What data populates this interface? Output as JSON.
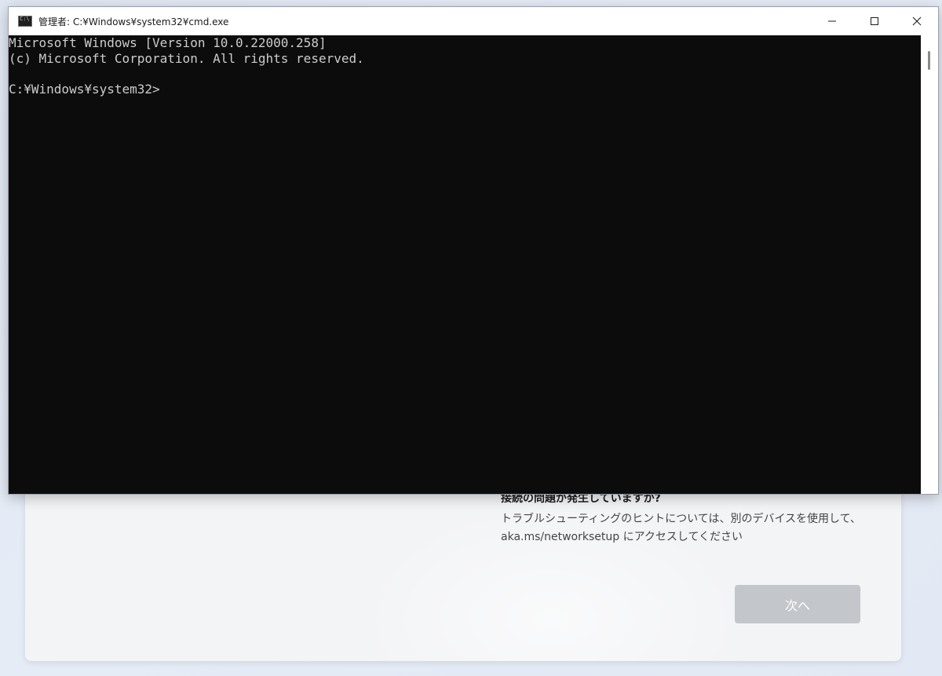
{
  "window": {
    "title": "管理者: C:¥Windows¥system32¥cmd.exe",
    "controls": {
      "minimize": "—",
      "maximize": "☐",
      "close": "✕"
    }
  },
  "terminal": {
    "lines": [
      "Microsoft Windows [Version 10.0.22000.258]",
      "(c) Microsoft Corporation. All rights reserved.",
      "",
      "C:¥Windows¥system32>"
    ]
  },
  "oobe": {
    "help_title": "接続の問題が発生していますか?",
    "help_text_line1": "トラブルシューティングのヒントについては、別のデバイスを使用して、",
    "help_text_line2": "aka.ms/networksetup にアクセスしてください",
    "next_label": "次へ"
  }
}
